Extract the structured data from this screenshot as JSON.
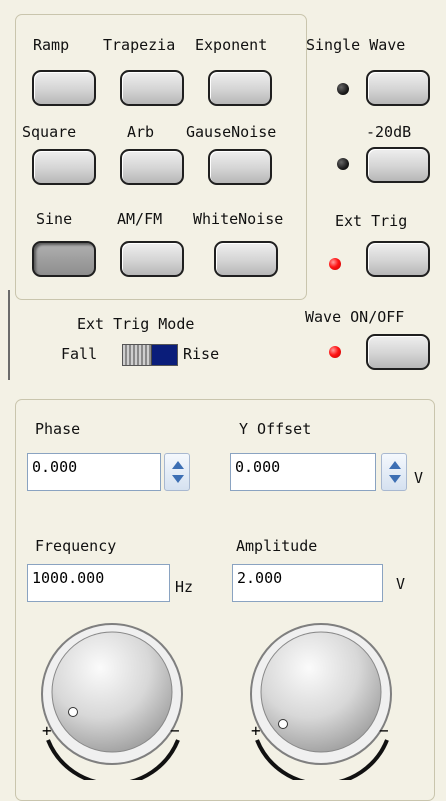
{
  "wave_buttons": [
    {
      "label": "Ramp"
    },
    {
      "label": "Trapezia"
    },
    {
      "label": "Exponent"
    },
    {
      "label": "Square"
    },
    {
      "label": "Arb"
    },
    {
      "label": "GauseNoise"
    },
    {
      "label": "Sine",
      "selected": true
    },
    {
      "label": "AM/FM"
    },
    {
      "label": "WhiteNoise"
    }
  ],
  "right_controls": {
    "single_wave": {
      "label": "Single Wave",
      "led": "off"
    },
    "minus20db": {
      "label": "-20dB",
      "led": "off"
    },
    "ext_trig": {
      "label": "Ext Trig",
      "led": "on"
    },
    "wave_onoff": {
      "label": "Wave ON/OFF",
      "led": "on"
    }
  },
  "trig_mode": {
    "title": "Ext Trig Mode",
    "left": "Fall",
    "right": "Rise"
  },
  "params": {
    "phase": {
      "label": "Phase",
      "value": "0.000"
    },
    "y_offset": {
      "label": "Y Offset",
      "value": "0.000",
      "unit": "V"
    },
    "frequency": {
      "label": "Frequency",
      "value": "1000.000",
      "unit": "Hz"
    },
    "amplitude": {
      "label": "Amplitude",
      "value": "2.000",
      "unit": "V"
    }
  },
  "knob_signs": {
    "plus": "+",
    "minus": "−"
  },
  "colors": {
    "background": "#f3f1e5",
    "led_on": "#ff1515",
    "led_off": "#111111",
    "toggle_fill": "#0a1d7a",
    "field_border": "#8aa3c1"
  }
}
